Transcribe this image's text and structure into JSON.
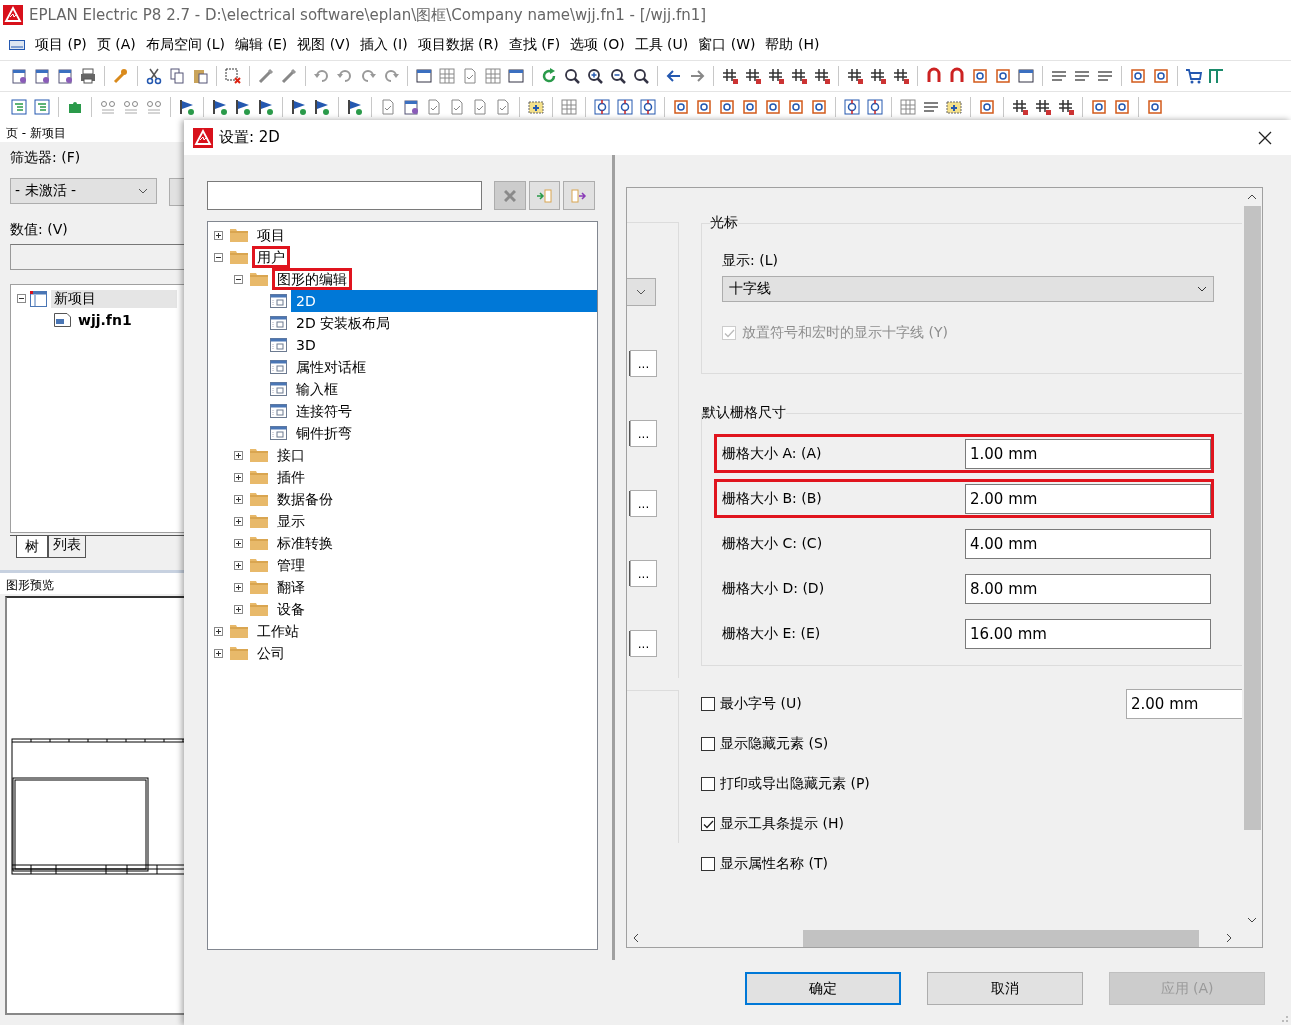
{
  "window": {
    "title": "EPLAN Electric P8 2.7 - D:\\electrical software\\eplan\\图框\\Company name\\wjj.fn1 - [/wjj.fn1]"
  },
  "menu": [
    "项目 (P)",
    "页 (A)",
    "布局空间 (L)",
    "编辑 (E)",
    "视图 (V)",
    "插入 (I)",
    "项目数据 (R)",
    "查找 (F)",
    "选项 (O)",
    "工具 (U)",
    "窗口 (W)",
    "帮助 (H)"
  ],
  "page_panel": {
    "title": "页 - 新项目",
    "filter_label": "筛选器: (F)",
    "filter_value": "- 未激活 -",
    "value_label": "数值: (V)",
    "tree": [
      {
        "label": "新项目",
        "kind": "project",
        "expanded": true,
        "selected": true,
        "children": [
          {
            "label": "wjj.fn1",
            "kind": "file",
            "selected": false
          }
        ]
      }
    ],
    "tabs": [
      {
        "label": "树",
        "selected": true
      },
      {
        "label": "列表",
        "selected": false
      }
    ],
    "preview_label": "图形预览"
  },
  "dialog": {
    "title": "设置: 2D",
    "tree": [
      {
        "label": "项目",
        "kind": "folder",
        "expanded": false,
        "selected": false,
        "highlighted": false
      },
      {
        "label": "用户",
        "kind": "folder",
        "expanded": true,
        "selected": false,
        "highlighted": true,
        "children": [
          {
            "label": "图形的编辑",
            "kind": "folder",
            "expanded": true,
            "selected": false,
            "highlighted": true,
            "children": [
              {
                "label": "2D",
                "kind": "page",
                "selected": true,
                "highlighted": false
              },
              {
                "label": "2D 安装板布局",
                "kind": "page",
                "selected": false,
                "highlighted": false
              },
              {
                "label": "3D",
                "kind": "page",
                "selected": false,
                "highlighted": false
              },
              {
                "label": "属性对话框",
                "kind": "page",
                "selected": false,
                "highlighted": false
              },
              {
                "label": "输入框",
                "kind": "page",
                "selected": false,
                "highlighted": false
              },
              {
                "label": "连接符号",
                "kind": "page",
                "selected": false,
                "highlighted": false
              },
              {
                "label": "铜件折弯",
                "kind": "page",
                "selected": false,
                "highlighted": false
              }
            ]
          },
          {
            "label": "接口",
            "kind": "folder",
            "expanded": false,
            "selected": false,
            "highlighted": false
          },
          {
            "label": "插件",
            "kind": "folder",
            "expanded": false,
            "selected": false,
            "highlighted": false
          },
          {
            "label": "数据备份",
            "kind": "folder",
            "expanded": false,
            "selected": false,
            "highlighted": false
          },
          {
            "label": "显示",
            "kind": "folder",
            "expanded": false,
            "selected": false,
            "highlighted": false
          },
          {
            "label": "标准转换",
            "kind": "folder",
            "expanded": false,
            "selected": false,
            "highlighted": false
          },
          {
            "label": "管理",
            "kind": "folder",
            "expanded": false,
            "selected": false,
            "highlighted": false
          },
          {
            "label": "翻译",
            "kind": "folder",
            "expanded": false,
            "selected": false,
            "highlighted": false
          },
          {
            "label": "设备",
            "kind": "folder",
            "expanded": false,
            "selected": false,
            "highlighted": false
          }
        ]
      },
      {
        "label": "工作站",
        "kind": "folder",
        "expanded": false,
        "selected": false,
        "highlighted": false
      },
      {
        "label": "公司",
        "kind": "folder",
        "expanded": false,
        "selected": false,
        "highlighted": false
      }
    ],
    "browse_buttons": [
      "...",
      "...",
      "...",
      "...",
      "..."
    ],
    "cursor_group": {
      "title": "光标",
      "display_label": "显示: (L)",
      "display_value": "十字线",
      "crosshair_option": {
        "label": "放置符号和宏时的显示十字线 (Y)",
        "checked": true,
        "disabled": true
      }
    },
    "grid_group": {
      "title": "默认栅格尺寸",
      "rows": [
        {
          "label": "栅格大小 A: (A)",
          "value": "1.00 mm",
          "highlighted": true
        },
        {
          "label": "栅格大小 B: (B)",
          "value": "2.00 mm",
          "highlighted": true
        },
        {
          "label": "栅格大小 C: (C)",
          "value": "4.00 mm",
          "highlighted": false
        },
        {
          "label": "栅格大小 D: (D)",
          "value": "8.00 mm",
          "highlighted": false
        },
        {
          "label": "栅格大小 E: (E)",
          "value": "16.00 mm",
          "highlighted": false
        }
      ]
    },
    "options": [
      {
        "label": "最小字号 (U)",
        "checked": false,
        "value": "2.00 mm"
      },
      {
        "label": "显示隐藏元素 (S)",
        "checked": false
      },
      {
        "label": "打印或导出隐藏元素 (P)",
        "checked": false
      },
      {
        "label": "显示工具条提示 (H)",
        "checked": true
      },
      {
        "label": "显示属性名称 (T)",
        "checked": false
      }
    ],
    "buttons": [
      {
        "label": "确定",
        "kind": "default",
        "disabled": false
      },
      {
        "label": "取消",
        "kind": "normal",
        "disabled": false
      },
      {
        "label": "应用 (A)",
        "kind": "normal",
        "disabled": true
      }
    ]
  }
}
